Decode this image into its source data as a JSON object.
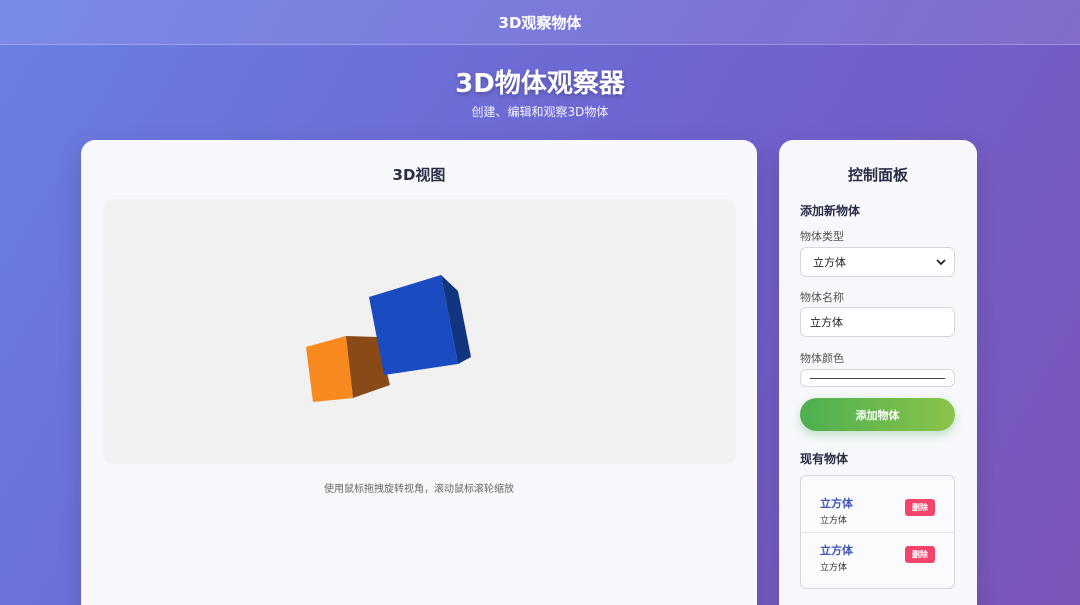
{
  "topbar": {
    "title": "3D观察物体"
  },
  "hero": {
    "title": "3D物体观察器",
    "subtitle": "创建、编辑和观察3D物体"
  },
  "view": {
    "title": "3D视图",
    "hint": "使用鼠标拖拽旋转视角，滚动鼠标滚轮缩放",
    "background": "#f1f1f1",
    "objects": [
      {
        "type": "cube",
        "color": "#f7891f"
      },
      {
        "type": "cube",
        "color": "#1a4bc0"
      }
    ]
  },
  "panel": {
    "title": "控制面板",
    "add_section": {
      "heading": "添加新物体",
      "type_label": "物体类型",
      "type_value": "立方体",
      "name_label": "物体名称",
      "name_value": "立方体",
      "color_label": "物体颜色",
      "add_button": "添加物体"
    },
    "existing_section": {
      "heading": "现有物体",
      "items": [
        {
          "name": "立方体",
          "type": "立方体",
          "delete_label": "删除"
        },
        {
          "name": "立方体",
          "type": "立方体",
          "delete_label": "删除"
        }
      ]
    }
  },
  "colors": {
    "accent_green": "#4caf50",
    "delete_red": "#f2456c",
    "link_blue": "#3f56b5"
  }
}
